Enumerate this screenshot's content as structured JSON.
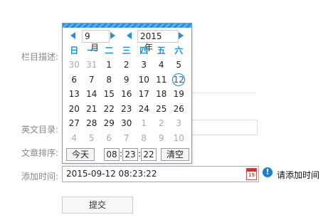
{
  "labels": {
    "column_desc": "栏目描述:",
    "english_dir": "英文目录:",
    "article_sort": "文章排序:",
    "add_time": "添加时间:"
  },
  "add_time": {
    "value": "2015-09-12 08:23:22",
    "tip": "请添加时间"
  },
  "submit_label": "提交",
  "calendar": {
    "month": "9",
    "month_unit": "月",
    "year": "2015",
    "year_unit": "年",
    "weekdays": [
      "日",
      "一",
      "二",
      "三",
      "四",
      "五",
      "六"
    ],
    "rows": [
      [
        "30",
        "31",
        "1",
        "2",
        "3",
        "4",
        "5"
      ],
      [
        "6",
        "7",
        "8",
        "9",
        "10",
        "11",
        "12"
      ],
      [
        "13",
        "14",
        "15",
        "16",
        "17",
        "18",
        "19"
      ],
      [
        "20",
        "21",
        "22",
        "23",
        "24",
        "25",
        "26"
      ],
      [
        "27",
        "28",
        "29",
        "30",
        "1",
        "2",
        "3"
      ],
      [
        "4",
        "5",
        "6",
        "7",
        "8",
        "9",
        "10"
      ]
    ],
    "today_label": "今天",
    "hour": "08",
    "minute": "23",
    "second": "22",
    "clear_label": "清空"
  }
}
